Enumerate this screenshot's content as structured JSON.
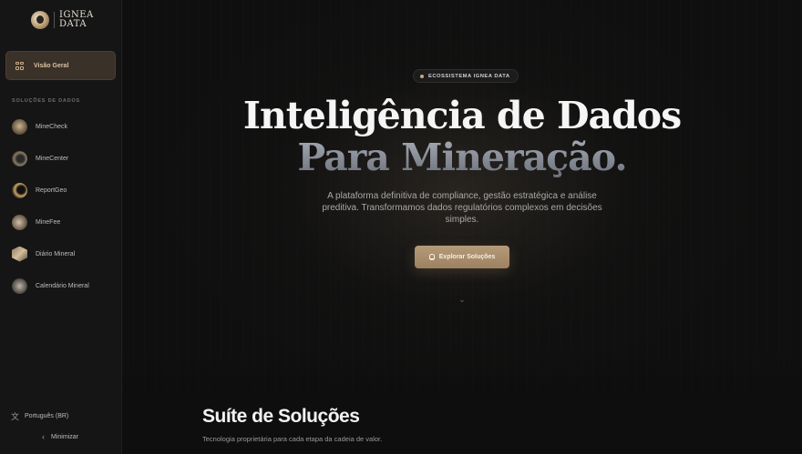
{
  "brand": {
    "name_line1": "IGNEA",
    "name_line2": "DATA"
  },
  "sidebar": {
    "overview_label": "Visão Geral",
    "section_title": "SOLUÇÕES DE DADOS",
    "items": [
      {
        "label": "MineCheck"
      },
      {
        "label": "MineCenter"
      },
      {
        "label": "ReportGeo"
      },
      {
        "label": "MineFee"
      },
      {
        "label": "Diário Mineral"
      },
      {
        "label": "Calendário Mineral"
      }
    ],
    "language_label": "Português (BR)",
    "minimize_label": "Minimizar"
  },
  "hero": {
    "badge": "ECOSSISTEMA IGNEA DATA",
    "title_line1": "Inteligência de Dados",
    "title_line2": "Para Mineração.",
    "description": "A plataforma definitiva de compliance, gestão estratégica e análise preditiva. Transformamos dados regulatórios complexos em decisões simples.",
    "cta_label": "Explorar Soluções"
  },
  "suite": {
    "title": "Suíte de Soluções",
    "subtitle": "Tecnologia proprietária para cada etapa da cadeia de valor."
  },
  "colors": {
    "accent": "#b69b79",
    "background": "#0e0e0e",
    "sidebar": "#151515"
  }
}
